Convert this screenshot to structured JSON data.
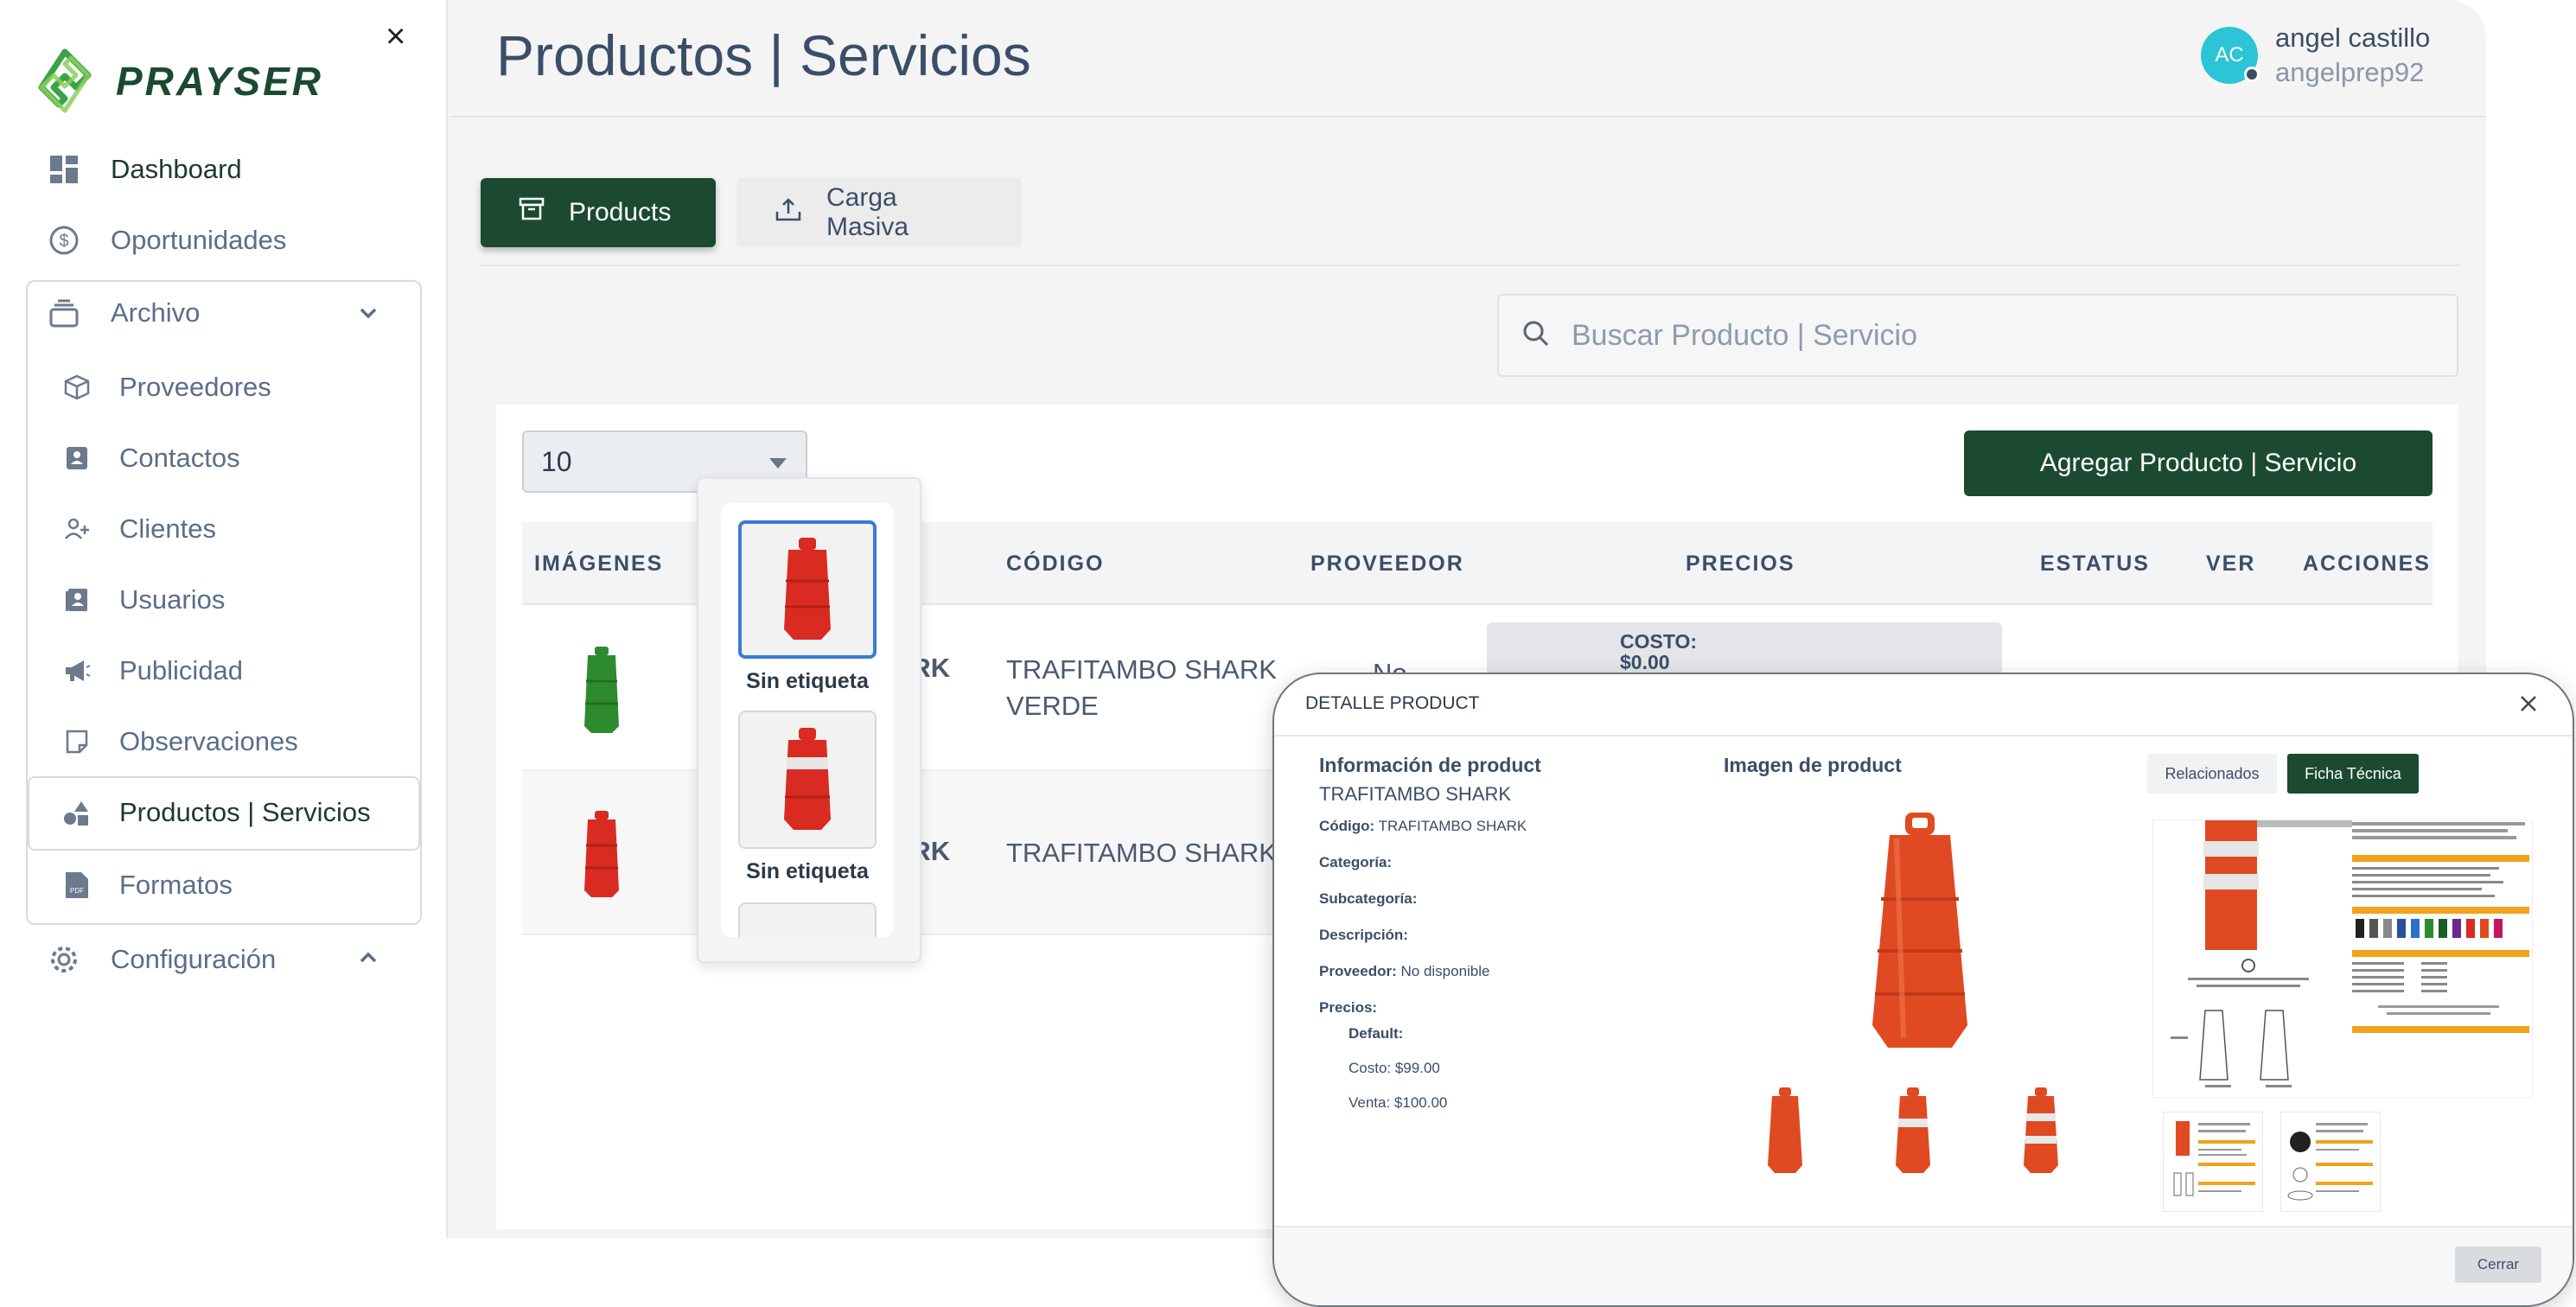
{
  "sidebar": {
    "brand": "PRAYSER",
    "close_glyph": "×",
    "items": [
      {
        "label": "Dashboard",
        "icon": "dashboard-icon"
      },
      {
        "label": "Oportunidades",
        "icon": "dollar-circle-icon"
      },
      {
        "label": "Archivo",
        "icon": "archive-icon"
      },
      {
        "label": "Configuración",
        "icon": "gear-icon"
      }
    ],
    "archivo_items": [
      {
        "label": "Proveedores",
        "icon": "box-icon"
      },
      {
        "label": "Contactos",
        "icon": "contact-card-icon"
      },
      {
        "label": "Clientes",
        "icon": "user-plus-icon"
      },
      {
        "label": "Usuarios",
        "icon": "users-book-icon"
      },
      {
        "label": "Publicidad",
        "icon": "megaphone-icon"
      },
      {
        "label": "Observaciones",
        "icon": "note-icon"
      },
      {
        "label": "Productos | Servicios",
        "icon": "shapes-icon"
      },
      {
        "label": "Formatos",
        "icon": "pdf-icon"
      }
    ]
  },
  "header": {
    "title": "Productos | Servicios",
    "user": {
      "initials": "AC",
      "name": "angel castillo",
      "handle": "angelprep92"
    }
  },
  "tabs": {
    "products": "Products",
    "carga_masiva": "Carga Masiva"
  },
  "search": {
    "placeholder": "Buscar Producto | Servicio"
  },
  "table": {
    "page_size": "10",
    "add_button": "Agregar Producto | Servicio",
    "columns": [
      "IMÁGENES",
      "CÓDIGO",
      "PROVEEDOR",
      "PRECIOS",
      "ESTATUS",
      "VER",
      "ACCIONES"
    ],
    "rows": [
      {
        "name_fragment": "ARK",
        "code_line1": "TRAFITAMBO SHARK",
        "code_line2": "VERDE",
        "proveedor_fragment": "No",
        "price_label": "COSTO:",
        "price_value": "$0.00",
        "image_color": "#2e8a2e"
      },
      {
        "name_fragment": "ARK",
        "code_line1": "TRAFITAMBO SHARK",
        "code_line2": "",
        "image_color": "#d92b22"
      }
    ]
  },
  "gallery": {
    "label_1": "Sin etiqueta",
    "label_2": "Sin etiqueta"
  },
  "modal": {
    "title": "DETALLE PRODUCT",
    "info_title": "Información de product",
    "product_name": "TRAFITAMBO SHARK",
    "codigo_label": "Código:",
    "codigo_value": "TRAFITAMBO SHARK",
    "categoria_label": "Categoría:",
    "subcategoria_label": "Subcategoría:",
    "descripcion_label": "Descripción:",
    "proveedor_label": "Proveedor:",
    "proveedor_value": "No disponible",
    "precios_label": "Precios:",
    "default_label": "Default:",
    "costo": "Costo: $99.00",
    "venta": "Venta: $100.00",
    "image_title": "Imagen de product",
    "tab_relacionados": "Relacionados",
    "tab_ficha": "Ficha Técnica",
    "close_button": "Cerrar"
  },
  "colors": {
    "brand_green": "#1b4a31",
    "accent_blue": "#3a7bd5",
    "cone_orange": "#d92b22",
    "cone_green": "#2e8a2e"
  }
}
